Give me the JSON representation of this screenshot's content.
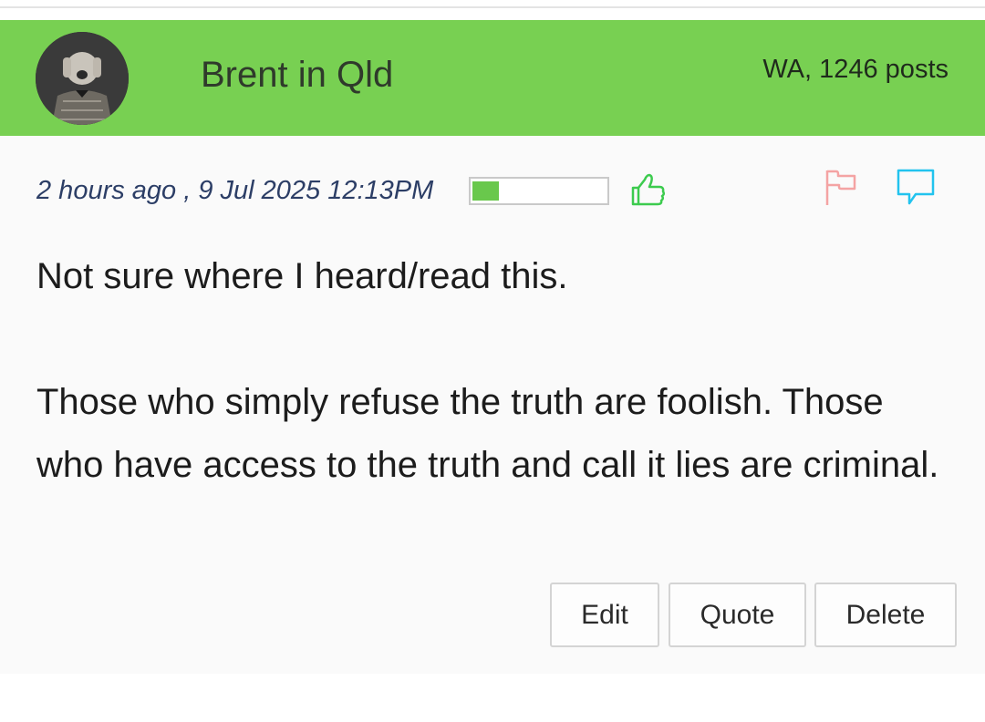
{
  "post": {
    "author": "Brent in Qld",
    "meta": "WA, 1246 posts",
    "avatar": "avatar-photo",
    "timestamp": "2 hours ago , 9 Jul 2025 12:13PM",
    "rating_level": 0.2,
    "message_lines": [
      "Not sure where I heard/read this.",
      "Those who simply refuse the truth are foolish. Those who have access to the truth and call it lies are criminal."
    ]
  },
  "icons": {
    "thumb": "thumbs-up-icon",
    "flag": "flag-icon",
    "comment": "comment-icon"
  },
  "actions": {
    "edit": "Edit",
    "quote": "Quote",
    "delete": "Delete"
  },
  "colors": {
    "header": "#78d052",
    "rating_fill": "#69c84c",
    "thumb": "#3ccb4e",
    "flag": "#f4a3a3",
    "comment": "#22c3ee"
  }
}
